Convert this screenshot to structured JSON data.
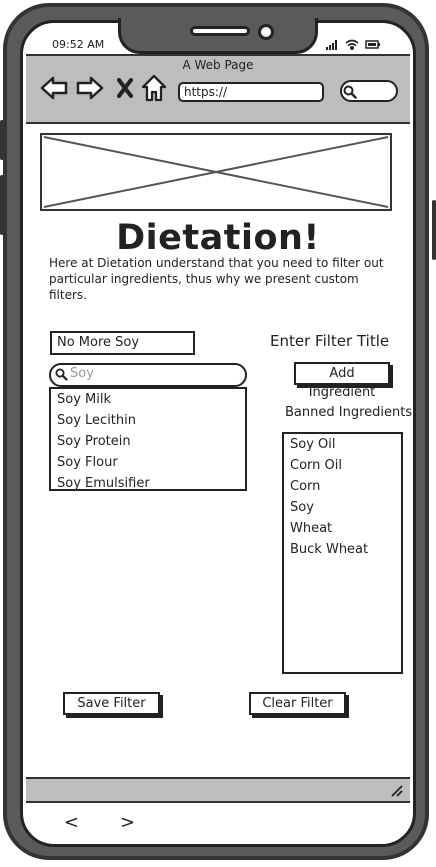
{
  "status": {
    "time": "09:52 AM"
  },
  "browser": {
    "page_title": "A Web Page",
    "url": "https://",
    "icons": [
      "back-arrow-icon",
      "forward-arrow-icon",
      "close-icon",
      "home-icon",
      "search-icon"
    ]
  },
  "main": {
    "headline": "Dietation!",
    "intro": "Here at Dietation understand that you need to filter out particular ingredients, thus why we present custom filters.",
    "filter_title_value": "No More Soy",
    "filter_title_label": "Enter Filter Title",
    "search": {
      "placeholder": "Soy"
    },
    "suggestions": [
      "Soy Milk",
      "Soy Lecithin",
      "Soy Protein",
      "Soy Flour",
      "Soy Emulsifier"
    ],
    "add_button": "Add Ingredient",
    "banned_label": "Banned Ingredients",
    "banned": [
      "Soy Oil",
      "Corn Oil",
      "Corn",
      "Soy",
      "Wheat",
      "Buck Wheat"
    ],
    "save_button": "Save Filter",
    "clear_button": "Clear Filter"
  },
  "bottom_nav": {
    "back": "<",
    "forward": ">"
  }
}
